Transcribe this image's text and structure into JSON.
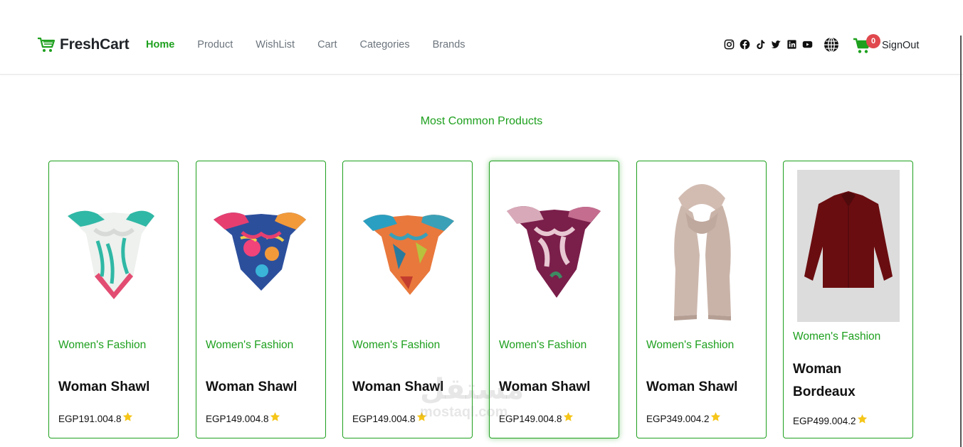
{
  "brand": {
    "name": "FreshCart",
    "icon": "cart-icon",
    "color": "#1ea01e"
  },
  "nav": {
    "links": [
      "Home",
      "Product",
      "WishList",
      "Cart",
      "Categories",
      "Brands"
    ],
    "active": "Home"
  },
  "header": {
    "social_icons": [
      "instagram-icon",
      "facebook-icon",
      "tiktok-icon",
      "twitter-icon",
      "linkedin-icon",
      "youtube-icon"
    ],
    "language_icon": "globe-icon",
    "cart_count": "0",
    "signout_label": "SignOut"
  },
  "section": {
    "title": "Most Common Products"
  },
  "products": [
    {
      "category": "Women's Fashion",
      "title": "Woman Shawl",
      "price": "EGP191.004.8",
      "image": "white-green-scarf"
    },
    {
      "category": "Women's Fashion",
      "title": "Woman Shawl",
      "price": "EGP149.004.8",
      "image": "colorful-pink-scarf"
    },
    {
      "category": "Women's Fashion",
      "title": "Woman Shawl",
      "price": "EGP149.004.8",
      "image": "orange-teal-scarf"
    },
    {
      "category": "Women's Fashion",
      "title": "Woman Shawl",
      "price": "EGP149.004.8",
      "image": "burgundy-floral-scarf"
    },
    {
      "category": "Women's Fashion",
      "title": "Woman Shawl",
      "price": "EGP349.004.2",
      "image": "beige-long-scarf"
    },
    {
      "category": "Women's Fashion",
      "title": "Woman Bordeaux",
      "price": "EGP499.004.2",
      "image": "bordeaux-shirt"
    }
  ],
  "watermark": {
    "arabic": "مستقل",
    "latin": "mostaql.com"
  },
  "colors": {
    "accent": "#1ea01e",
    "badge": "#e0484e",
    "star": "#f5c518"
  }
}
